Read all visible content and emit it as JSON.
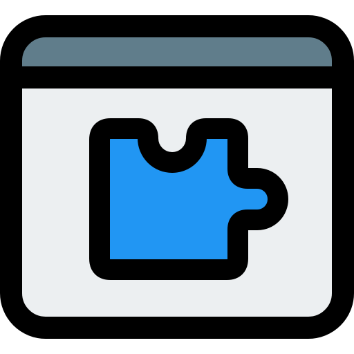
{
  "icon": {
    "semantic": "browser-extension-puzzle-icon",
    "parts": [
      "browser-window-icon",
      "puzzle-piece-icon"
    ]
  },
  "colors": {
    "outline": "#000000",
    "title_bar": "#607d8b",
    "window_body": "#eceff1",
    "puzzle_piece": "#2196f3",
    "background": "#ffffff"
  }
}
